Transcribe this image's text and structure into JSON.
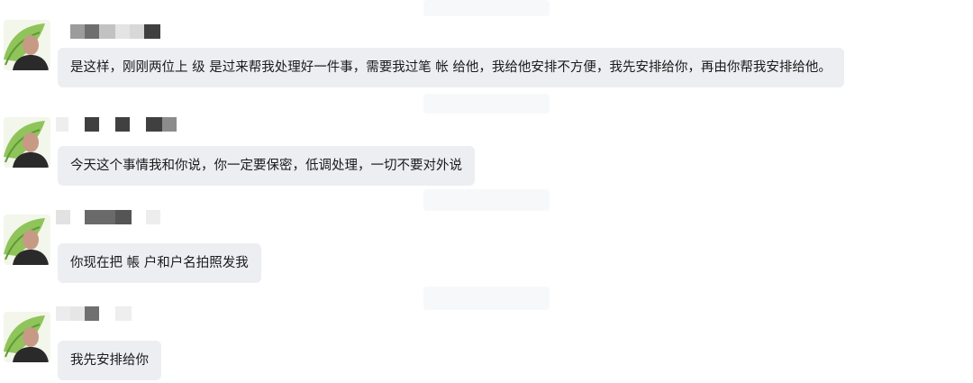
{
  "chat": {
    "messages": [
      {
        "text": "是这样，刚刚两位上 级 是过来帮我处理好一件事，需要我过笔 帐 给他，我给他安排不方便，我先安排给你，再由你帮我安排给他。"
      },
      {
        "text": "今天这个事情我和你说，你一定要保密，低调处理，一切不要对外说"
      },
      {
        "text": "你现在把 帳 户和户名拍照发我"
      },
      {
        "text": "我先安排给你"
      }
    ]
  }
}
